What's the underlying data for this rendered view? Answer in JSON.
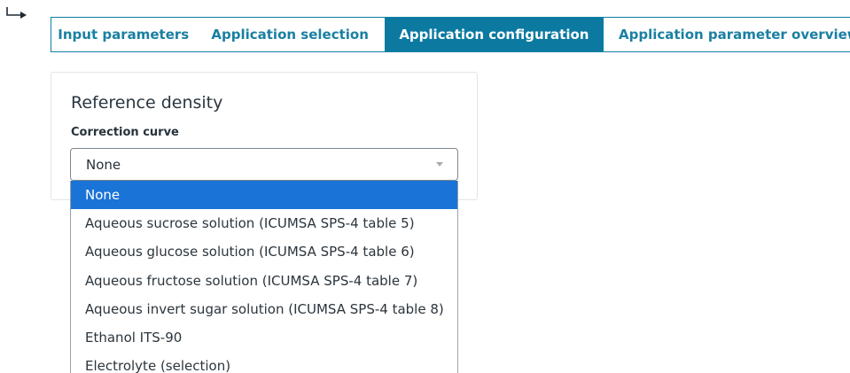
{
  "tabs": [
    {
      "label": "Input parameters"
    },
    {
      "label": "Application selection"
    },
    {
      "label": "Application configuration",
      "active": true
    },
    {
      "label": "Application parameter overview"
    }
  ],
  "card": {
    "title": "Reference density",
    "field_label": "Correction curve"
  },
  "select": {
    "value": "None",
    "options": [
      "None",
      "Aqueous sucrose solution (ICUMSA SPS-4 table 5)",
      "Aqueous glucose solution (ICUMSA SPS-4 table 6)",
      "Aqueous fructose solution (ICUMSA SPS-4 table 7)",
      "Aqueous invert sugar solution (ICUMSA SPS-4 table 8)",
      "Ethanol ITS-90",
      "Electrolyte (selection)"
    ]
  },
  "colors": {
    "accent": "#0c7aa0",
    "selected_option": "#1a73d6"
  }
}
